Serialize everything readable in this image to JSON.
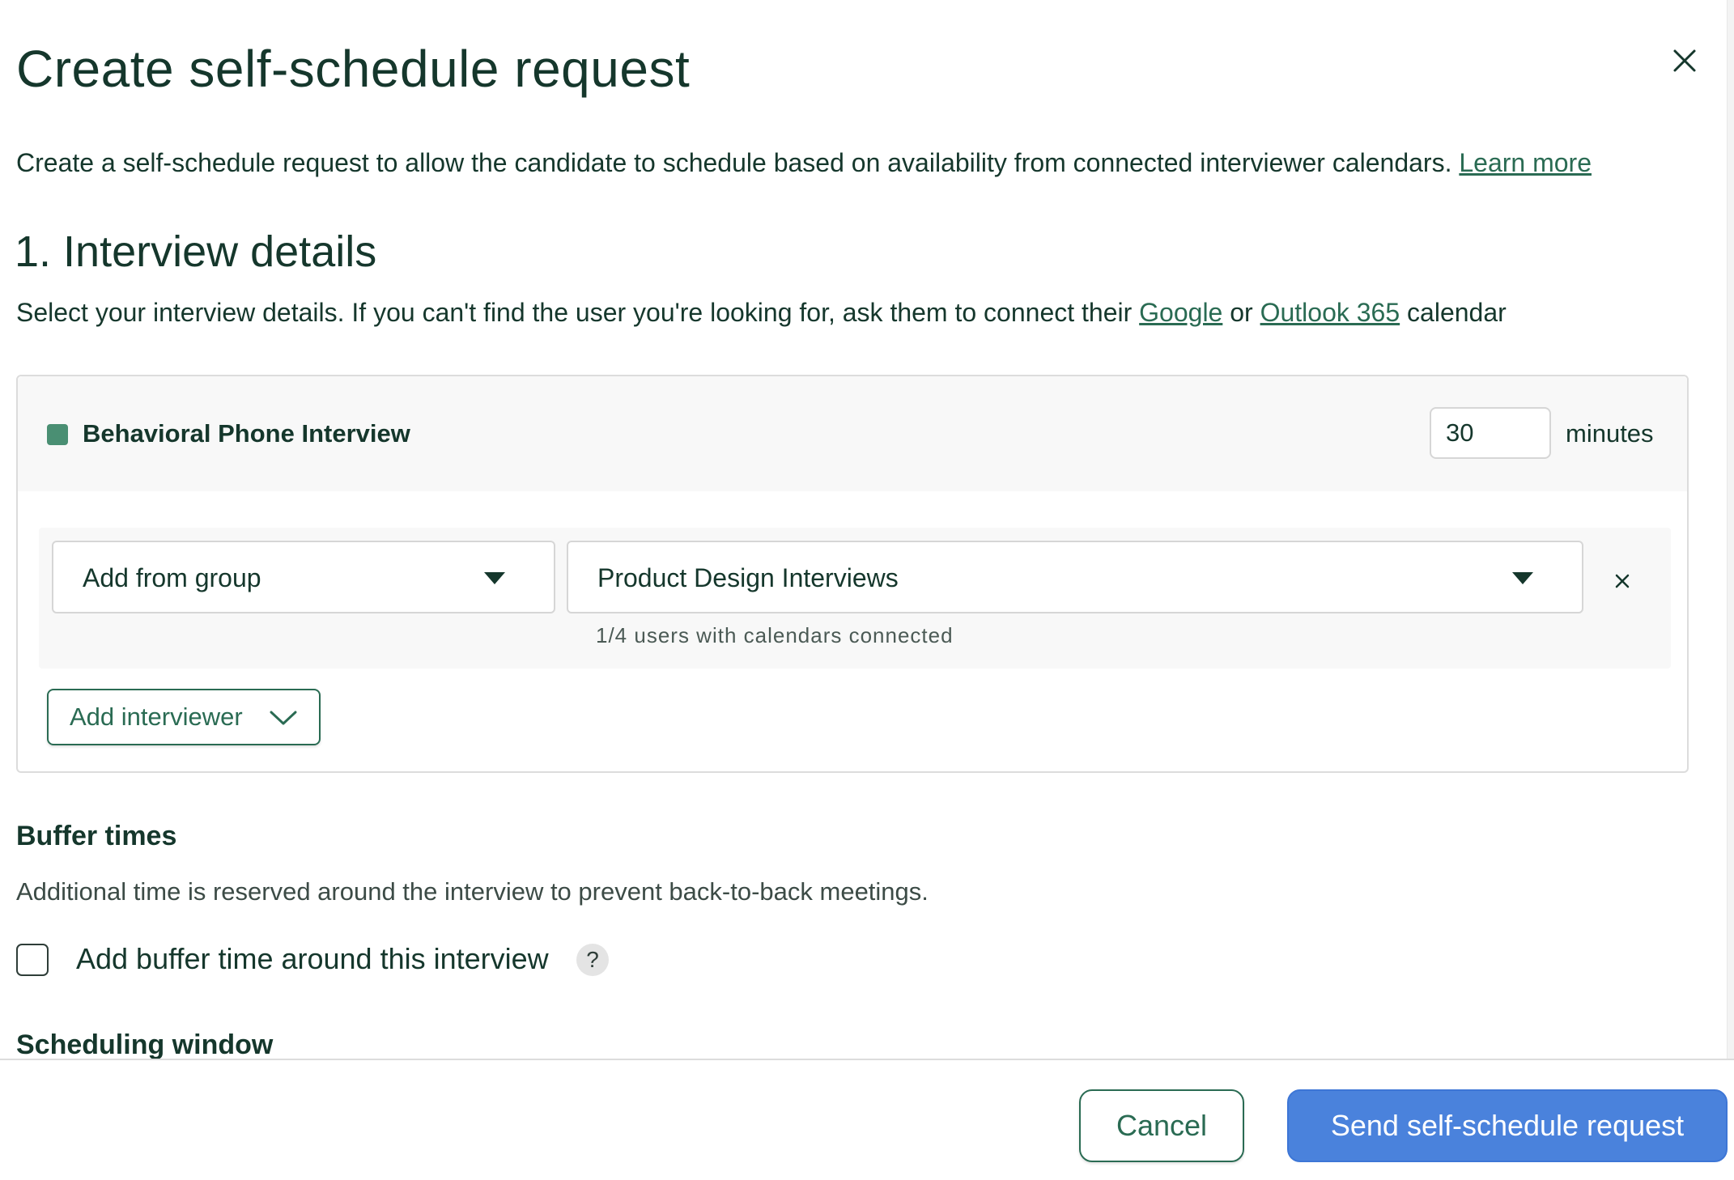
{
  "dialog": {
    "title": "Create self-schedule request",
    "intro_text": "Create a self-schedule request to allow the candidate to schedule based on availability from connected interviewer calendars.",
    "learn_more": "Learn more"
  },
  "section1": {
    "heading": "1. Interview details",
    "desc_prefix": "Select your interview details. If you can't find the user you're looking for, ask them to connect their",
    "google_link": "Google",
    "or_text": "or",
    "outlook_link": "Outlook 365",
    "desc_suffix": "calendar"
  },
  "interview": {
    "name": "Behavioral Phone Interview",
    "color": "#4a8f73",
    "duration_value": "30",
    "duration_unit": "minutes",
    "source_select": "Add from group",
    "group_select": "Product Design Interviews",
    "helper_text": "1/4 users with calendars connected",
    "add_interviewer": "Add interviewer"
  },
  "buffer": {
    "heading": "Buffer times",
    "description": "Additional time is reserved around the interview to prevent back-to-back meetings.",
    "checkbox_label": "Add buffer time around this interview",
    "checked": false,
    "help_icon": "?"
  },
  "scheduling_window": {
    "heading": "Scheduling window"
  },
  "footer": {
    "cancel": "Cancel",
    "send": "Send self-schedule request"
  },
  "colors": {
    "primary_text": "#15372c",
    "accent_green": "#2a6b53",
    "primary_blue": "#4a82dc"
  }
}
